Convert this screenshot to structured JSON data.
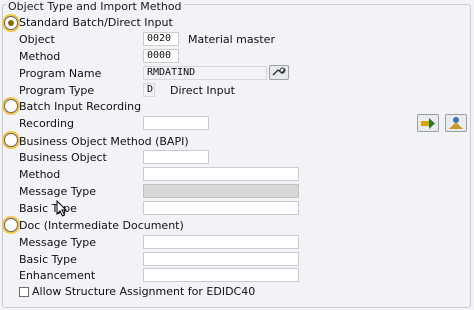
{
  "title": "Object Type and Import Method",
  "sections": {
    "standard": {
      "label": "Standard Batch/Direct Input",
      "selected": true,
      "object_label": "Object",
      "object_value": "0020",
      "object_desc": "Material master",
      "method_label": "Method",
      "method_value": "0000",
      "program_name_label": "Program Name",
      "program_name_value": "RMDATIND",
      "program_type_label": "Program Type",
      "program_type_value": "D",
      "program_type_desc": "Direct Input"
    },
    "batch": {
      "label": "Batch Input Recording",
      "recording_label": "Recording",
      "recording_value": ""
    },
    "bapi": {
      "label": "Business Object Method  (BAPI)",
      "business_object_label": "Business Object",
      "method_label": "Method",
      "message_type_label": "Message Type",
      "basic_type_label": "Basic Type"
    },
    "idoc": {
      "label": "Doc (Intermediate Document)",
      "message_type_label": "Message Type",
      "basic_type_label": "Basic Type",
      "enhancement_label": "Enhancement"
    }
  },
  "checkbox": {
    "label": "Allow Structure Assignment for EDIDC40",
    "checked": false
  },
  "icons": {
    "program_search": "search-icon",
    "execute": "execute-icon",
    "display": "display-icon"
  },
  "colors": {
    "highlight": "#f2c64b",
    "background": "#f2f3f6",
    "disabled_field": "#d7d7d7"
  }
}
